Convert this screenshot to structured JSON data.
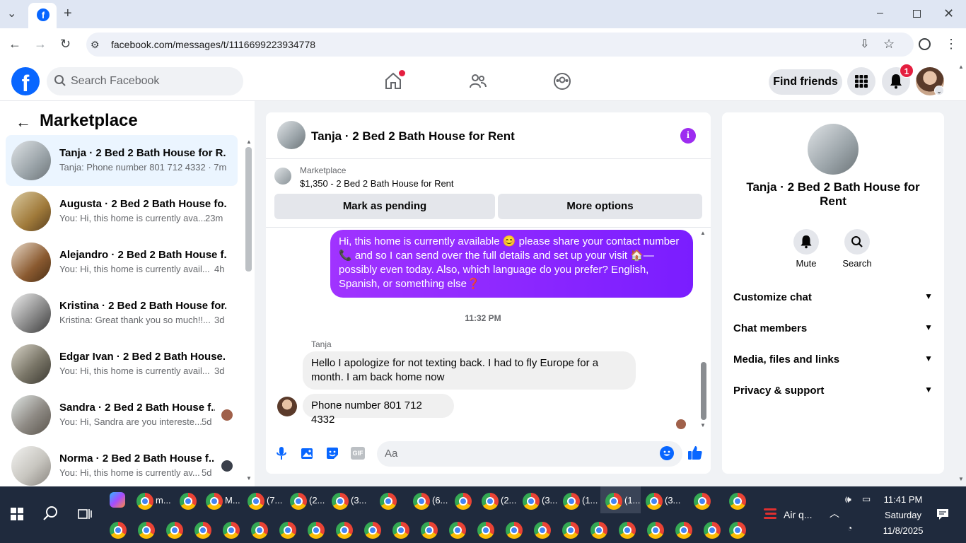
{
  "browser": {
    "url": "facebook.com/messages/t/1116699223934778"
  },
  "header": {
    "search_placeholder": "Search Facebook",
    "find_friends": "Find friends",
    "notif_count": "1"
  },
  "sidebar": {
    "title": "Marketplace",
    "conversations": [
      {
        "title": "Tanja · 2 Bed 2 Bath House for R...",
        "preview": "Tanja: Phone number 801 712 4332 · 7m",
        "time": ""
      },
      {
        "title": "Augusta · 2 Bed 2 Bath House fo...",
        "preview": "You: Hi, this home is currently ava...",
        "time": "23m"
      },
      {
        "title": "Alejandro · 2 Bed 2 Bath House f...",
        "preview": "You: Hi, this home is currently avail...",
        "time": "4h"
      },
      {
        "title": "Kristina · 2 Bed 2 Bath House for...",
        "preview": "Kristina: Great thank you so much!!...",
        "time": "3d"
      },
      {
        "title": "Edgar Ivan · 2 Bed 2 Bath House...",
        "preview": "You: Hi, this home is currently avail...",
        "time": "3d"
      },
      {
        "title": "Sandra · 2 Bed 2 Bath House f...",
        "preview": "You: Hi, Sandra are you intereste...",
        "time": "5d"
      },
      {
        "title": "Norma · 2 Bed 2 Bath House f...",
        "preview": "You: Hi, this home is currently av...",
        "time": "5d"
      }
    ]
  },
  "chat": {
    "title": "Tanja · 2 Bed 2 Bath House for Rent",
    "listing_label": "Marketplace",
    "listing_price": "$1,350 - 2 Bed 2 Bath House for Rent",
    "mark_pending": "Mark as pending",
    "more_options": "More options",
    "outgoing": "Hi, this home is currently available 😊 please share your contact number 📞 and  so I can send over the full details and set up your visit 🏠— possibly even today. Also, which language do you prefer? English, Spanish, or something else❓",
    "time": "11:32 PM",
    "sender": "Tanja",
    "incoming1": "Hello I apologize for not texting back. I had to fly Europe for a month. I am back home now",
    "incoming2": "Phone number 801 712 4332",
    "composer_placeholder": "Aa"
  },
  "details": {
    "title": "Tanja · 2 Bed 2 Bath House for Rent",
    "mute": "Mute",
    "search": "Search",
    "sections": [
      "Customize chat",
      "Chat members",
      "Media, files and links",
      "Privacy & support"
    ]
  },
  "taskbar": {
    "items": [
      "m...",
      "M...",
      "(7...",
      "(2...",
      "(3...",
      "(6...",
      "(2...",
      "(3...",
      "(1...",
      "(1...",
      "(3..."
    ],
    "weather": "Air q...",
    "time": "11:41 PM",
    "day": "Saturday",
    "date": "11/8/2025"
  }
}
